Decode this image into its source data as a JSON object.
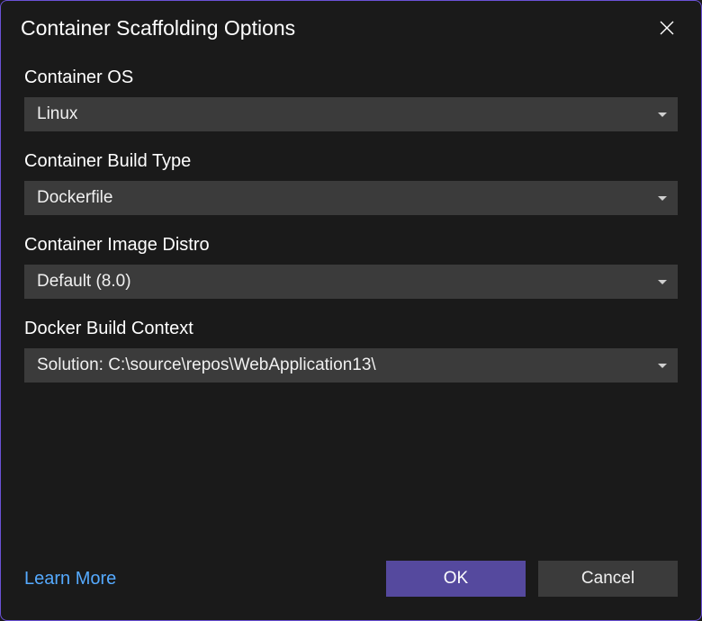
{
  "dialog": {
    "title": "Container Scaffolding Options",
    "fields": {
      "container_os": {
        "label": "Container OS",
        "value": "Linux"
      },
      "build_type": {
        "label": "Container Build Type",
        "value": "Dockerfile"
      },
      "image_distro": {
        "label": "Container Image Distro",
        "value": "Default (8.0)"
      },
      "build_context": {
        "label": "Docker Build Context",
        "value": "Solution: C:\\source\\repos\\WebApplication13\\"
      }
    },
    "link": "Learn More",
    "buttons": {
      "ok": "OK",
      "cancel": "Cancel"
    }
  }
}
